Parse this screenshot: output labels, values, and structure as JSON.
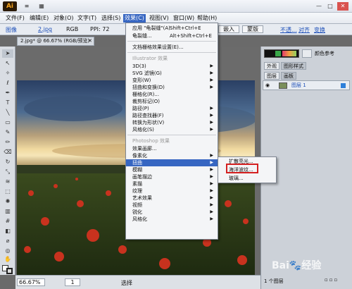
{
  "title_bar": {
    "logo": "Ai",
    "brush": "≡",
    "view": "▦",
    "minimize": "—",
    "restore": "□",
    "close": "✕"
  },
  "menubar": {
    "items": [
      {
        "label": "文件(F)"
      },
      {
        "label": "编辑(E)"
      },
      {
        "label": "对象(O)"
      },
      {
        "label": "文字(T)"
      },
      {
        "label": "选择(S)"
      },
      {
        "label": "效果(C)"
      },
      {
        "label": "视图(V)"
      },
      {
        "label": "窗口(W)"
      },
      {
        "label": "帮助(H)"
      }
    ]
  },
  "control_bar": {
    "mode": "图像",
    "filename": "2.jpg",
    "colormode": "RGB",
    "ppi": "PPI: 72",
    "embed_button": "嵌入",
    "mask_button": "蒙版",
    "opacity_link": "不透...",
    "align_link": "对齐",
    "transform_link": "变换"
  },
  "document_tab": {
    "label": "2.jpg* @ 66.67% (RGB/预览)",
    "close": "✕"
  },
  "effects_menu": {
    "apply_last": {
      "label": "应用 \"龟裂缝\"(A)",
      "shortcut": "Shift+Ctrl+E"
    },
    "last_effect": {
      "label": "龟裂缝...",
      "shortcut": "Alt+Shift+Ctrl+E"
    },
    "raster_settings": "文档栅格效果设置(E)...",
    "illustrator_header": "Illustrator 效果",
    "illustrator_items": [
      "3D(3)",
      "SVG 滤镜(G)",
      "变形(W)",
      "扭曲和变换(D)",
      "栅格化(R)...",
      "裁剪标记(O)",
      "路径(P)",
      "路径查找器(F)",
      "转换为形状(V)",
      "风格化(S)"
    ],
    "photoshop_header": "Photoshop 效果",
    "gallery": "效果画廊...",
    "photoshop_items": [
      "像素化",
      "扭曲",
      "模糊",
      "画笔描边",
      "素描",
      "纹理",
      "艺术效果",
      "视频",
      "锐化",
      "风格化"
    ]
  },
  "distort_submenu": {
    "items": [
      "扩散亮光...",
      "海洋波纹...",
      "玻璃..."
    ],
    "highlighted": "海洋波纹..."
  },
  "right_panel": {
    "tabs_top": [
      "外观",
      "图形样式"
    ],
    "color_tab": "颜色参考",
    "tabs_layers": [
      "图层",
      "画板"
    ],
    "layer_name": "图层 1",
    "layer_count": "1 个图层"
  },
  "status_bar": {
    "zoom": "66.67%",
    "page": "1",
    "tool": "选择"
  },
  "watermark": "Bai🐾经验"
}
